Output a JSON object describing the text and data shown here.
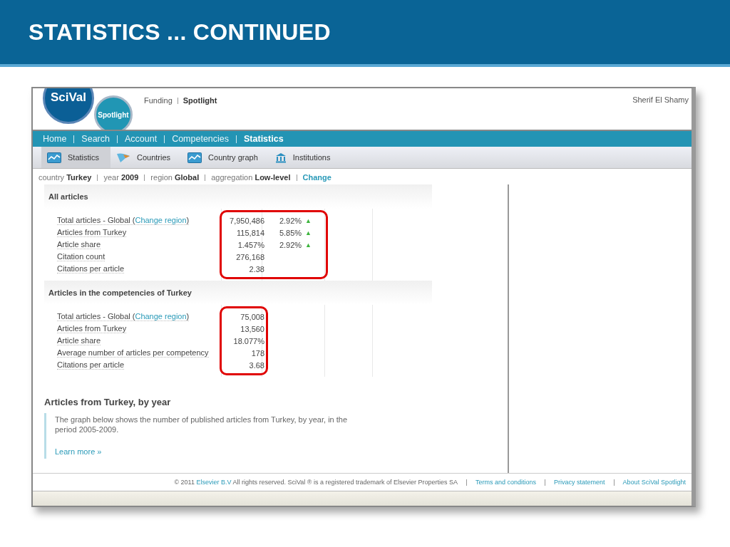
{
  "slide": {
    "title": "STATISTICS ... CONTINUED"
  },
  "app": {
    "logo": {
      "main": "SciVal",
      "sub": "Spotlight"
    },
    "top_links": [
      {
        "label": "Funding",
        "selected": false
      },
      {
        "label": "Spotlight",
        "selected": true
      }
    ],
    "user": "Sherif El Shamy",
    "nav": [
      {
        "label": "Home",
        "selected": false
      },
      {
        "label": "Search",
        "selected": false
      },
      {
        "label": "Account",
        "selected": false
      },
      {
        "label": "Competencies",
        "selected": false
      },
      {
        "label": "Statistics",
        "selected": true
      }
    ],
    "subtabs": [
      {
        "label": "Statistics",
        "kind": "graph",
        "selected": true
      },
      {
        "label": "Countries",
        "kind": "flag",
        "selected": false
      },
      {
        "label": "Country graph",
        "kind": "graph",
        "selected": false
      },
      {
        "label": "Institutions",
        "kind": "building",
        "selected": false
      }
    ],
    "filters": [
      {
        "label": "country",
        "value": "Turkey"
      },
      {
        "label": "year",
        "value": "2009"
      },
      {
        "label": "region",
        "value": "Global"
      },
      {
        "label": "aggregation",
        "value": "Low-level"
      }
    ],
    "change_link": "Change",
    "sections": [
      {
        "title": "All articles",
        "highlight": true,
        "rows": [
          {
            "label": "Total articles - Global (",
            "link": "Change region",
            "label_end": ")",
            "value": "7,950,486",
            "change": "2.92%",
            "trend": "▲"
          },
          {
            "label": "Articles from Turkey",
            "value": "115,814",
            "change": "5.85%",
            "trend": "▲"
          },
          {
            "label": "Article share",
            "value": "1.457%",
            "change": "2.92%",
            "trend": "▲"
          },
          {
            "label": "Citation count",
            "value": "276,168"
          },
          {
            "label": "Citations per article",
            "value": "2.38"
          }
        ]
      },
      {
        "title": "Articles in the competencies of Turkey",
        "highlight": true,
        "rows": [
          {
            "label": "Total articles - Global (",
            "link": "Change region",
            "label_end": ")",
            "value": "75,008"
          },
          {
            "label": "Articles from Turkey",
            "value": "13,560"
          },
          {
            "label": "Article share",
            "value": "18.077%"
          },
          {
            "label": "Average number of articles per competency",
            "value": "178"
          },
          {
            "label": "Citations per article",
            "value": "3.68"
          }
        ]
      }
    ],
    "graph_section": {
      "title": "Articles from Turkey, by year",
      "text": "The graph below shows the number of published articles from Turkey, by year, in the period 2005-2009.",
      "link": "Learn more »"
    },
    "footer": {
      "copyright_start": "© 2011",
      "company_link": "Elsevier B.V",
      "copyright_end": "All rights reserved. SciVal ® is a registered trademark of Elsevier Properties SA",
      "links": [
        "Terms and conditions",
        "Privacy statement",
        "About SciVal Spotlight"
      ]
    }
  }
}
